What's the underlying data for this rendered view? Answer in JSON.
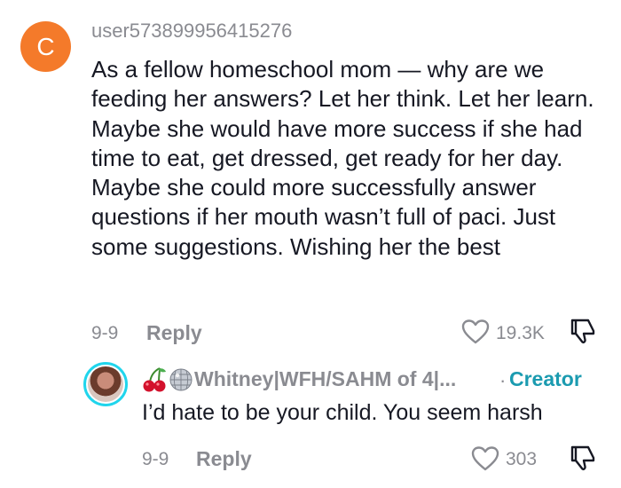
{
  "comment": {
    "avatar_letter": "C",
    "avatar_color": "#f47a2a",
    "username": "user573899956415276",
    "text": "As a fellow homeschool mom — why are we feeding her answers? Let her think. Let her learn. Maybe she would have more success if she had time to eat, get dressed, get ready for her day. Maybe she could more successfully answer questions if her mouth wasn’t full of paci. Just some suggestions. Wishing her the best",
    "date": "9-9",
    "reply_label": "Reply",
    "likes": "19.3K",
    "like_icon": "heart-outline-icon",
    "dislike_icon": "thumbs-down-outline-icon"
  },
  "reply": {
    "avatar_ring_color": "#20d5ec",
    "emoji_1": "cherries-icon",
    "emoji_2": "disco-ball-icon",
    "username": "Whitney|WFH/SAHM of 4|...",
    "dot": "·",
    "creator_label": "Creator",
    "creator_color": "#1b9bb0",
    "text": "I’d hate to be your child. You seem harsh",
    "date": "9-9",
    "reply_label": "Reply",
    "likes": "303"
  }
}
